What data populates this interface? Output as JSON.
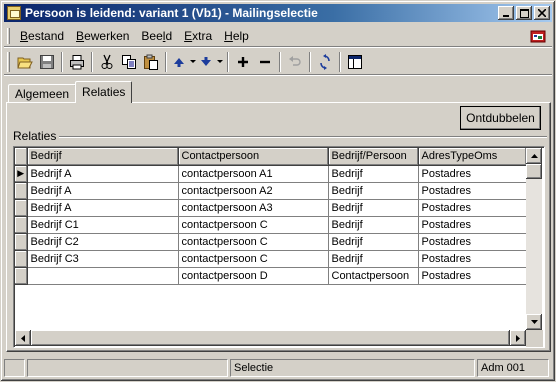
{
  "window": {
    "title": "Persoon is leidend: variant 1 (Vb1) - Mailingselectie"
  },
  "titlebar": {
    "minimize": "_",
    "maximize": "□",
    "close": "×"
  },
  "menu": {
    "items": [
      {
        "accel": "B",
        "rest": "estand"
      },
      {
        "accel": "B",
        "rest": "ewerken"
      },
      {
        "pre": "Bee",
        "accel": "l",
        "rest": "d"
      },
      {
        "accel": "E",
        "rest": "xtra"
      },
      {
        "accel": "H",
        "rest": "elp"
      }
    ]
  },
  "tabs": [
    {
      "label": "Algemeen"
    },
    {
      "label": "Relaties"
    }
  ],
  "buttons": {
    "ontdubbelen": "Ontdubbelen"
  },
  "group": {
    "label": "Relaties"
  },
  "grid": {
    "columns": [
      "Bedrijf",
      "Contactpersoon",
      "Bedrijf/Persoon",
      "AdresTypeOms"
    ],
    "rows": [
      [
        "Bedrijf A",
        "contactpersoon A1",
        "Bedrijf",
        "Postadres"
      ],
      [
        "Bedrijf A",
        "contactpersoon A2",
        "Bedrijf",
        "Postadres"
      ],
      [
        "Bedrijf A",
        "contactpersoon A3",
        "Bedrijf",
        "Postadres"
      ],
      [
        "Bedrijf C1",
        "contactpersoon C",
        "Bedrijf",
        "Postadres"
      ],
      [
        "Bedrijf C2",
        "contactpersoon C",
        "Bedrijf",
        "Postadres"
      ],
      [
        "Bedrijf C3",
        "contactpersoon C",
        "Bedrijf",
        "Postadres"
      ],
      [
        "",
        "contactpersoon D",
        "Contactpersoon",
        "Postadres"
      ]
    ],
    "current_row_marker": "▶"
  },
  "status": {
    "panel1": "",
    "panel2": "",
    "panel3": "Selectie",
    "panel4": "Adm 001"
  },
  "colors": {
    "title_start": "#0a246a",
    "title_end": "#a6caf0",
    "face": "#d4d0c8"
  }
}
